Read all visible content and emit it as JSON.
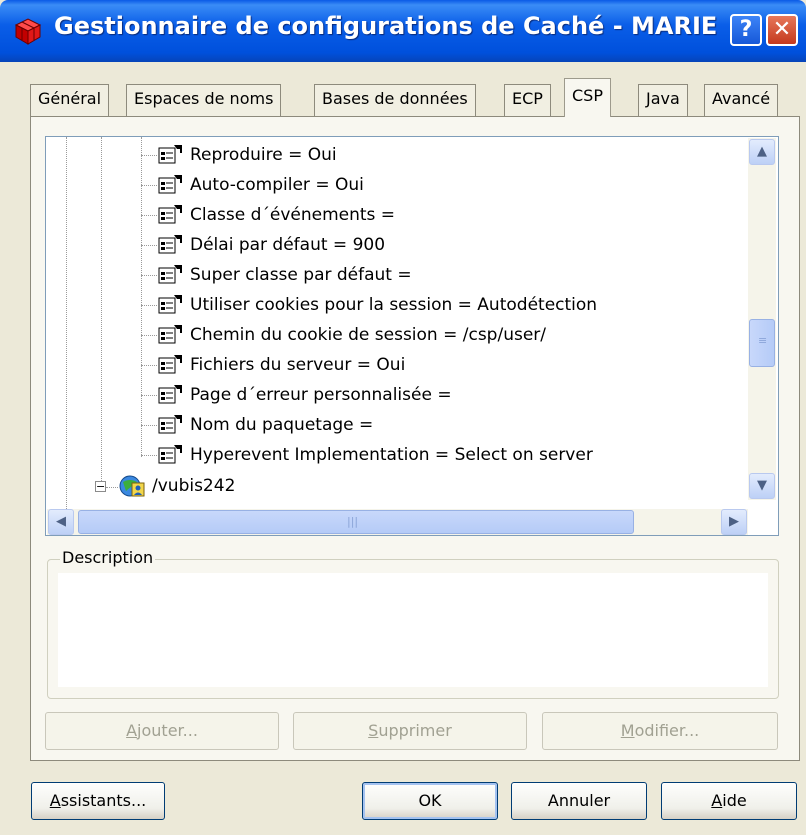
{
  "window": {
    "title": "Gestionnaire de configurations de Caché - MARIE",
    "help_glyph": "?",
    "close_glyph": "✕"
  },
  "tabs": [
    {
      "label": "Général"
    },
    {
      "label": "Espaces de noms"
    },
    {
      "label": "Bases de données"
    },
    {
      "label": "ECP"
    },
    {
      "label": "CSP"
    },
    {
      "label": "Java"
    },
    {
      "label": "Avancé"
    }
  ],
  "active_tab": "CSP",
  "tree": {
    "items": [
      {
        "label": "Reproduire = Oui",
        "icon": "property-icon"
      },
      {
        "label": "Auto-compiler = Oui",
        "icon": "property-icon"
      },
      {
        "label": "Classe d´événements =",
        "icon": "property-icon"
      },
      {
        "label": "Délai par défaut = 900",
        "icon": "property-icon"
      },
      {
        "label": "Super classe par défaut =",
        "icon": "property-icon"
      },
      {
        "label": "Utiliser cookies pour la session = Autodétection",
        "icon": "property-icon"
      },
      {
        "label": "Chemin du cookie de session = /csp/user/",
        "icon": "property-icon"
      },
      {
        "label": "Fichiers du serveur = Oui",
        "icon": "property-icon"
      },
      {
        "label": "Page d´erreur personnalisée =",
        "icon": "property-icon"
      },
      {
        "label": "Nom du paquetage =",
        "icon": "property-icon"
      },
      {
        "label": "Hyperevent Implementation = Select on server",
        "icon": "property-icon"
      }
    ],
    "folder": {
      "label": "/vubis242",
      "icon": "csp-application-icon",
      "expander": "−"
    }
  },
  "description": {
    "label": "Description",
    "text": ""
  },
  "buttons": {
    "add": {
      "prefix": "",
      "accel": "A",
      "rest": "jouter..."
    },
    "delete": {
      "prefix": "",
      "accel": "S",
      "rest": "upprimer"
    },
    "modify": {
      "prefix": "",
      "accel": "M",
      "rest": "odifier..."
    },
    "wizards": {
      "prefix": "",
      "accel": "A",
      "rest": "ssistants..."
    },
    "ok": {
      "label": "OK"
    },
    "cancel": {
      "label": "Annuler"
    },
    "help": {
      "prefix": "",
      "accel": "A",
      "rest": "ide"
    }
  },
  "scrollbars": {
    "up": "▲",
    "down": "▼",
    "left": "◀",
    "right": "▶",
    "v_position_fraction": 0.5
  }
}
